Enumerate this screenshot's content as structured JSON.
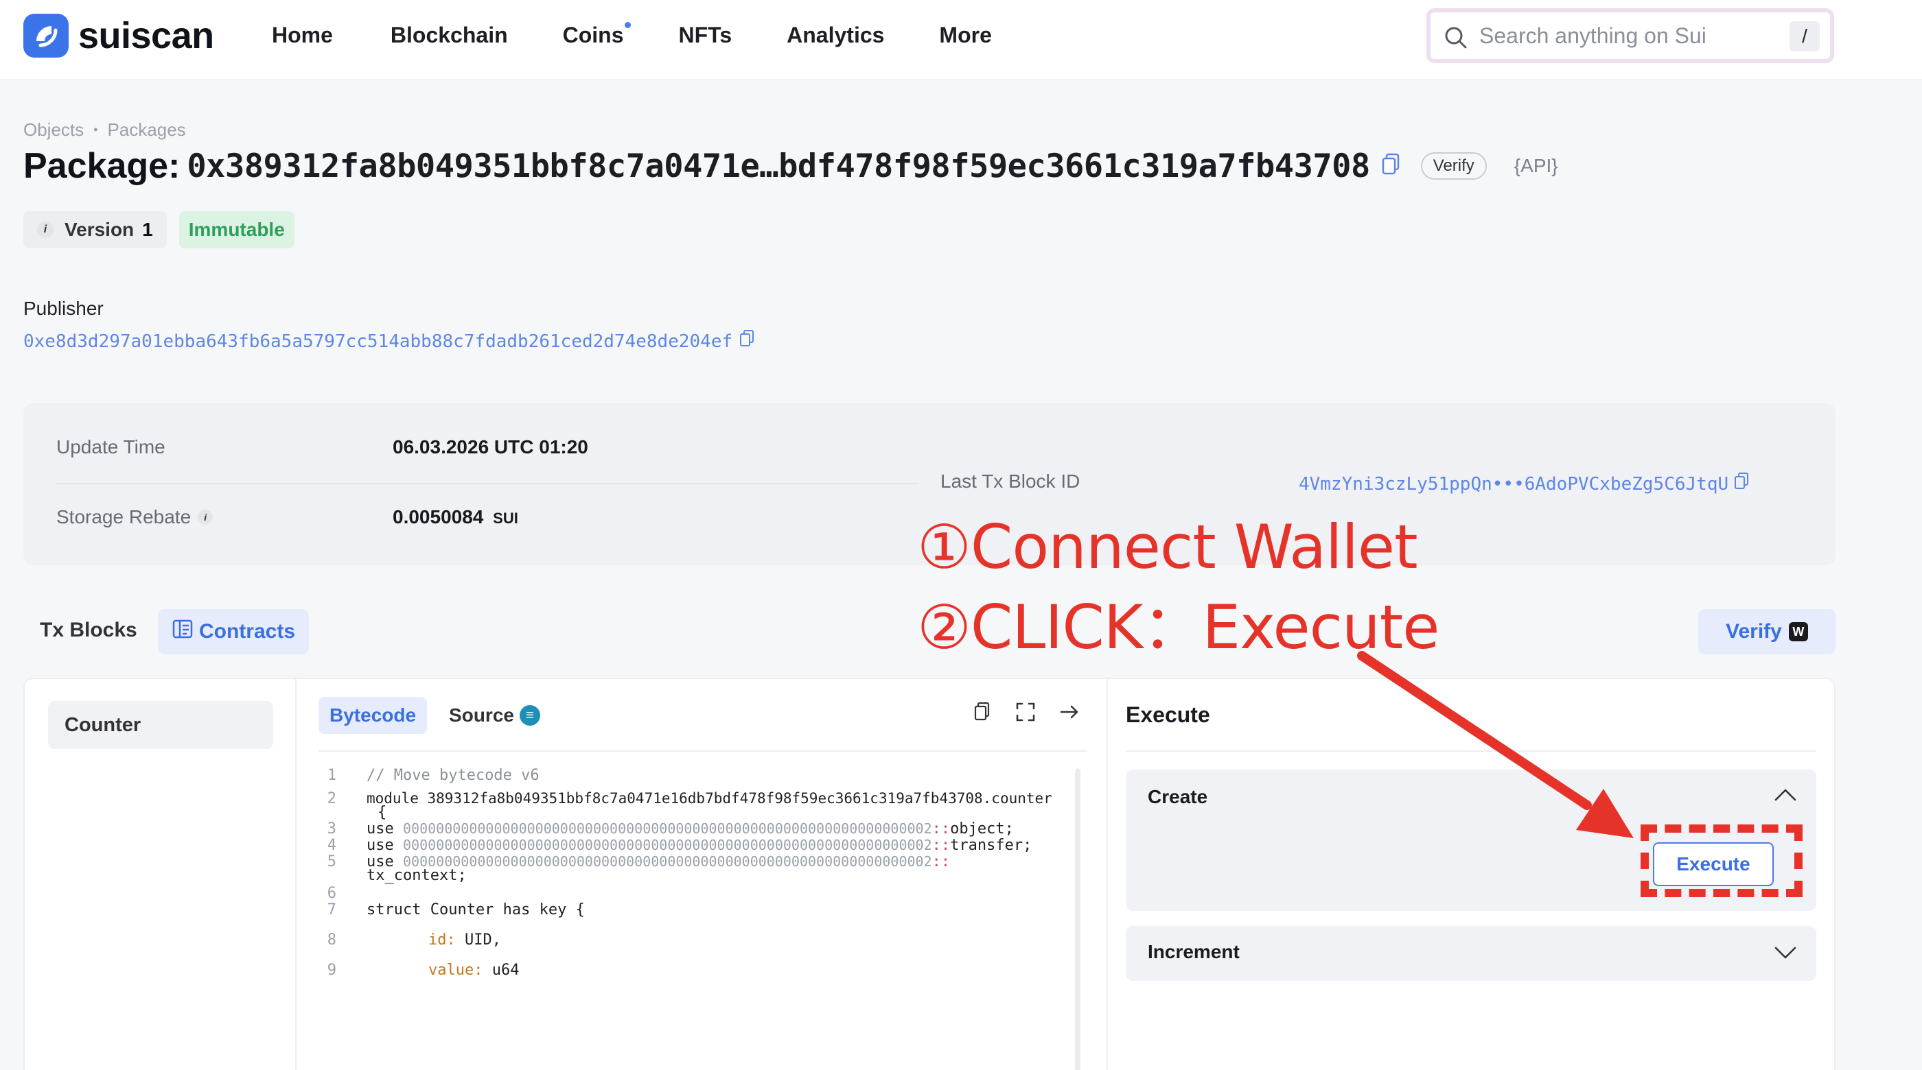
{
  "app": {
    "name": "suiscan",
    "accent": "#3b73e8",
    "link_color": "#5d86e6",
    "annotation_color": "#e6332a"
  },
  "nav": [
    {
      "label": "Home"
    },
    {
      "label": "Blockchain"
    },
    {
      "label": "Coins",
      "has_dot": true
    },
    {
      "label": "NFTs"
    },
    {
      "label": "Analytics"
    },
    {
      "label": "More"
    }
  ],
  "search": {
    "placeholder": "Search anything on Sui",
    "shortcut": "/"
  },
  "breadcrumb": [
    "Objects",
    "Packages"
  ],
  "package": {
    "title_label": "Package:",
    "address": "0x389312fa8b049351bbf8c7a0471e…bdf478f98f59ec3661c319a7fb43708",
    "verify_label": "Verify",
    "api_label": "{API}",
    "version_label": "Version",
    "version_value": "1",
    "immutable_label": "Immutable"
  },
  "publisher": {
    "label": "Publisher",
    "address": "0xe8d3d297a01ebba643fb6a5a5797cc514abb88c7fdadb261ced2d74e8de204ef"
  },
  "info": {
    "update_time_label": "Update Time",
    "update_time_value": "06.03.2026 UTC 01:20",
    "storage_rebate_label": "Storage Rebate",
    "storage_rebate_value": "0.0050084",
    "storage_rebate_unit": "SUI",
    "last_tx_label": "Last Tx Block ID",
    "last_tx_value": "4VmzYni3czLy51ppQn•••6AdoPVCxbeZg5C6JtqU"
  },
  "annotations": [
    "①Connect Wallet",
    "②CLICK：Execute"
  ],
  "tabs": {
    "tx_blocks": "Tx Blocks",
    "contracts": "Contracts",
    "verify": "Verify"
  },
  "modules": [
    "Counter"
  ],
  "code": {
    "tab_bytecode": "Bytecode",
    "tab_source": "Source",
    "lines": [
      {
        "n": "1",
        "text": "// Move bytecode v6"
      },
      {
        "n": "2",
        "text": "module 389312fa8b049351bbf8c7a0471e16db7bdf478f98f59ec3661c319a7fb43708.counter"
      },
      {
        "n": "",
        "text": "{"
      },
      {
        "n": "3",
        "kw": "use",
        "addr": "0000000000000000000000000000000000000000000000000000000000000002",
        "op": "::",
        "name": "object;"
      },
      {
        "n": "4",
        "kw": "use",
        "addr": "0000000000000000000000000000000000000000000000000000000000000002",
        "op": "::",
        "name": "transfer;"
      },
      {
        "n": "5",
        "kw": "use",
        "addr": "0000000000000000000000000000000000000000000000000000000000000002",
        "op": "::",
        "name": ""
      },
      {
        "n": "",
        "text": "tx_context;"
      },
      {
        "n": "6",
        "text": ""
      },
      {
        "n": "7",
        "text": "struct Counter has key {"
      },
      {
        "n": "8",
        "field": "id:",
        "type": "UID,"
      },
      {
        "n": "9",
        "field": "value:",
        "type": "u64"
      }
    ]
  },
  "execute": {
    "title": "Execute",
    "functions": [
      {
        "name": "Create",
        "expanded": true,
        "button": "Execute"
      },
      {
        "name": "Increment",
        "expanded": false
      }
    ]
  }
}
